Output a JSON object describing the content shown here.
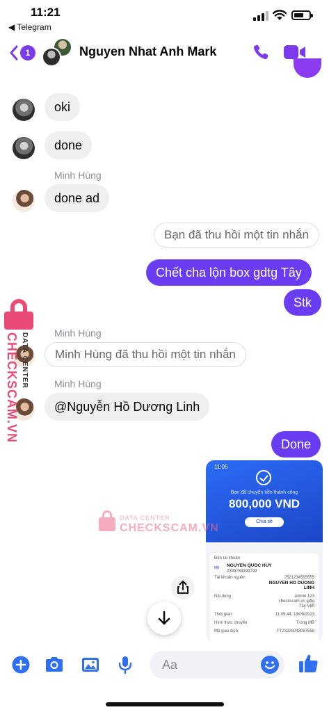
{
  "status_bar": {
    "time": "11:21",
    "back_app": "◀ Telegram",
    "battery_percent": 55
  },
  "header": {
    "unread_count": "1",
    "title": "Nguyen Nhat Anh Mark"
  },
  "messages": [
    {
      "direction": "in",
      "sender": "",
      "text": "oki"
    },
    {
      "direction": "in",
      "sender": "",
      "text": "done"
    },
    {
      "direction": "in",
      "sender": "Minh Hùng",
      "text": "done ad"
    },
    {
      "direction": "out",
      "recalled": true,
      "text": "Bạn đã thu hồi một tin nhắn"
    },
    {
      "direction": "out",
      "text": "Chết cha lộn box gdtg Tây"
    },
    {
      "direction": "out",
      "text": "Stk"
    },
    {
      "direction": "in",
      "sender": "Minh Hùng",
      "recalled": true,
      "text": "Minh Hùng đã thu hồi một tin nhắn"
    },
    {
      "direction": "in",
      "sender": "Minh Hùng",
      "text": "@Nguyễn Hồ Dương Linh"
    },
    {
      "direction": "out",
      "text": "Done"
    }
  ],
  "receipt": {
    "time": "11:05",
    "message": "Bạn đã chuyển tiền thành công",
    "amount": "800,000 VND",
    "share_label": "Chia sẻ",
    "to_label": "Đến tài khoản",
    "to_name": "NGUYEN QUOC HUY",
    "to_account": "0399789399799",
    "to_bank": "Quân Đội (MB)",
    "bank_logo": "MB",
    "rows": [
      {
        "label": "Tài khoản nguồn",
        "value": "2521234555555"
      },
      {
        "label": "",
        "value": "NGUYEN HO DUONG"
      },
      {
        "label": "",
        "value": "LINH"
      },
      {
        "label": "Nội dung",
        "value": "Admin 123"
      },
      {
        "label": "",
        "value": "checkscam.vn gdtg"
      },
      {
        "label": "",
        "value": "Tây-Việt"
      },
      {
        "label": "Thời gian",
        "value": "11:05:44, 13/08/2023"
      },
      {
        "label": "Hình thức chuyển",
        "value": "Trong MB"
      },
      {
        "label": "Mã giao dịch",
        "value": "FT23226043087558"
      }
    ]
  },
  "watermark": {
    "brand": "CHECKSCAM.VN",
    "tagline": "DATA CENTER"
  },
  "composer": {
    "placeholder": "Aa"
  },
  "colors": {
    "accent": "#7c3aed",
    "outgoing_bubble": "#6a3cf2",
    "icon_blue": "#2f6ff0",
    "watermark": "#e94b76"
  },
  "icons": [
    "back-chevron-icon",
    "phone-icon",
    "video-camera-icon",
    "plus-icon",
    "camera-icon",
    "gallery-icon",
    "microphone-icon",
    "emoji-icon",
    "thumbs-up-icon",
    "share-icon",
    "arrow-down-icon",
    "lock-icon",
    "checkmark-icon"
  ]
}
